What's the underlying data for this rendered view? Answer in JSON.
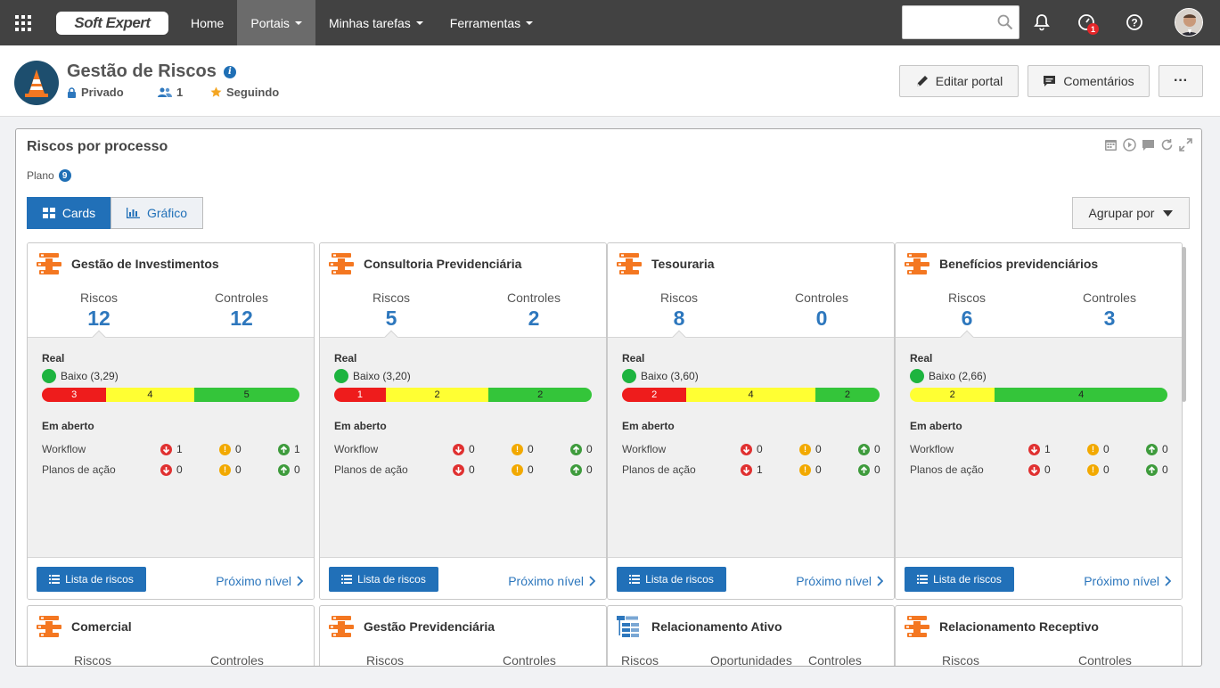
{
  "nav": {
    "logo": "Soft Expert",
    "items": [
      {
        "label": "Home",
        "dropdown": false,
        "active": false
      },
      {
        "label": "Portais",
        "dropdown": true,
        "active": true
      },
      {
        "label": "Minhas tarefas",
        "dropdown": true,
        "active": false
      },
      {
        "label": "Ferramentas",
        "dropdown": true,
        "active": false
      }
    ],
    "search_placeholder": "",
    "notification_count": "1"
  },
  "header": {
    "title": "Gestão de Riscos",
    "privacy": "Privado",
    "members": "1",
    "following": "Seguindo",
    "edit_label": "Editar portal",
    "comments_label": "Comentários",
    "more_label": "···"
  },
  "panel": {
    "title": "Riscos por processo",
    "plano_label": "Plano",
    "plano_count": "9",
    "tab_cards": "Cards",
    "tab_grafico": "Gráfico",
    "group_label": "Agrupar por"
  },
  "labels": {
    "riscos": "Riscos",
    "controles": "Controles",
    "oportunidades": "Oportunidades",
    "real": "Real",
    "em_aberto": "Em aberto",
    "workflow": "Workflow",
    "planos": "Planos de ação",
    "lista": "Lista de riscos",
    "proximo": "Próximo nível"
  },
  "cards": [
    {
      "title": "Gestão de Investimentos",
      "riscos": "12",
      "controles": "12",
      "level": "Baixo (3,29)",
      "bar": [
        {
          "v": "3",
          "c": "r",
          "w": 25
        },
        {
          "v": "4",
          "c": "y",
          "w": 34
        },
        {
          "v": "5",
          "c": "g",
          "w": 41
        }
      ],
      "workflow": [
        "1",
        "0",
        "1"
      ],
      "planos": [
        "0",
        "0",
        "0"
      ]
    },
    {
      "title": "Consultoria Previdenciária",
      "riscos": "5",
      "controles": "2",
      "level": "Baixo (3,20)",
      "bar": [
        {
          "v": "1",
          "c": "r",
          "w": 20
        },
        {
          "v": "2",
          "c": "y",
          "w": 40
        },
        {
          "v": "2",
          "c": "g",
          "w": 40
        }
      ],
      "workflow": [
        "0",
        "0",
        "0"
      ],
      "planos": [
        "0",
        "0",
        "0"
      ]
    },
    {
      "title": "Tesouraria",
      "riscos": "8",
      "controles": "0",
      "level": "Baixo (3,60)",
      "bar": [
        {
          "v": "2",
          "c": "r",
          "w": 25
        },
        {
          "v": "4",
          "c": "y",
          "w": 50
        },
        {
          "v": "2",
          "c": "g",
          "w": 25
        }
      ],
      "workflow": [
        "0",
        "0",
        "0"
      ],
      "planos": [
        "1",
        "0",
        "0"
      ]
    },
    {
      "title": "Benefícios previdenciários",
      "riscos": "6",
      "controles": "3",
      "level": "Baixo (2,66)",
      "bar": [
        {
          "v": "2",
          "c": "y",
          "w": 33
        },
        {
          "v": "4",
          "c": "g",
          "w": 67
        }
      ],
      "workflow": [
        "1",
        "0",
        "0"
      ],
      "planos": [
        "0",
        "0",
        "0"
      ]
    }
  ],
  "cards_row2": [
    {
      "title": "Comercial",
      "cols": [
        "Riscos",
        "Controles"
      ]
    },
    {
      "title": "Gestão Previdenciária",
      "cols": [
        "Riscos",
        "Controles"
      ]
    },
    {
      "title": "Relacionamento Ativo",
      "cols": [
        "Riscos",
        "Oportunidades",
        "Controles"
      ]
    },
    {
      "title": "Relacionamento Receptivo",
      "cols": [
        "Riscos",
        "Controles"
      ]
    }
  ]
}
